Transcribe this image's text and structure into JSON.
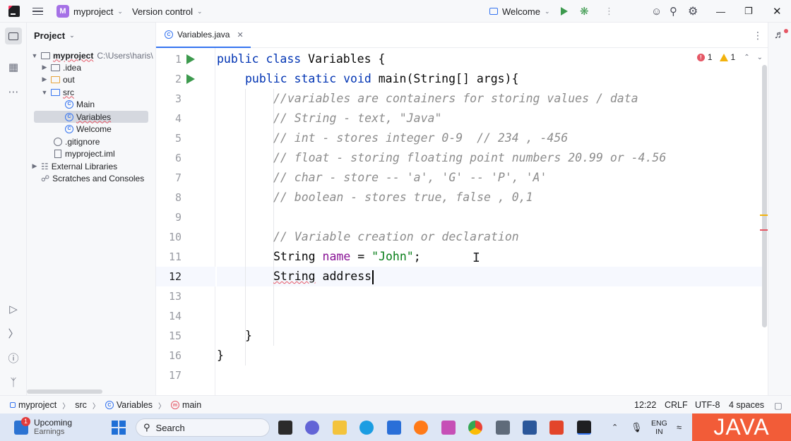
{
  "titlebar": {
    "project_badge": "M",
    "project_name": "myproject",
    "vcs_label": "Version control",
    "run_config": "Welcome"
  },
  "project_panel": {
    "title": "Project",
    "root_name": "myproject",
    "root_path": "C:\\Users\\haris\\",
    "items": [
      {
        "label": ".idea"
      },
      {
        "label": "out"
      },
      {
        "label": "src"
      },
      {
        "label": "Main"
      },
      {
        "label": "Variables"
      },
      {
        "label": "Welcome"
      },
      {
        "label": ".gitignore"
      },
      {
        "label": "myproject.iml"
      },
      {
        "label": "External Libraries"
      },
      {
        "label": "Scratches and Consoles"
      }
    ]
  },
  "editor": {
    "tab_label": "Variables.java",
    "inspections": {
      "errors": "1",
      "warnings": "1"
    },
    "line_numbers": [
      "1",
      "2",
      "3",
      "4",
      "5",
      "6",
      "7",
      "8",
      "9",
      "10",
      "11",
      "12",
      "13",
      "14",
      "15",
      "16",
      "17"
    ],
    "lines": {
      "l1_kw": "public class ",
      "l1_rest": "Variables {",
      "l2_kw": "public static void ",
      "l2_rest": "main(String[] args){",
      "l3": "//variables are containers for storing values / data",
      "l4": "// String - text, \"Java\"",
      "l5": "// int - stores integer 0-9  // 234 , -456",
      "l6": "// float - storing floating point numbers 20.99 or -4.56",
      "l7": "// char - store -- 'a', 'G' -- 'P', 'A'",
      "l8": "// boolean - stores true, false , 0,1",
      "l10": "// Variable creation or declaration",
      "l11_type": "String ",
      "l11_name": "name",
      "l11_eq": " = ",
      "l11_str": "\"John\"",
      "l11_end": ";",
      "l12_type": "String",
      "l12_name": " address",
      "l15": "}",
      "l16": "}"
    }
  },
  "statusbar": {
    "crumb_project": "myproject",
    "crumb_src": "src",
    "crumb_class": "Variables",
    "crumb_method": "main",
    "position": "12:22",
    "line_sep": "CRLF",
    "encoding": "UTF-8",
    "indent": "4 spaces"
  },
  "taskbar": {
    "notif_count": "1",
    "widget_title": "Upcoming",
    "widget_sub": "Earnings",
    "search_label": "Search",
    "lang_top": "ENG",
    "lang_bottom": "IN",
    "overlay_text": "JAVA"
  }
}
